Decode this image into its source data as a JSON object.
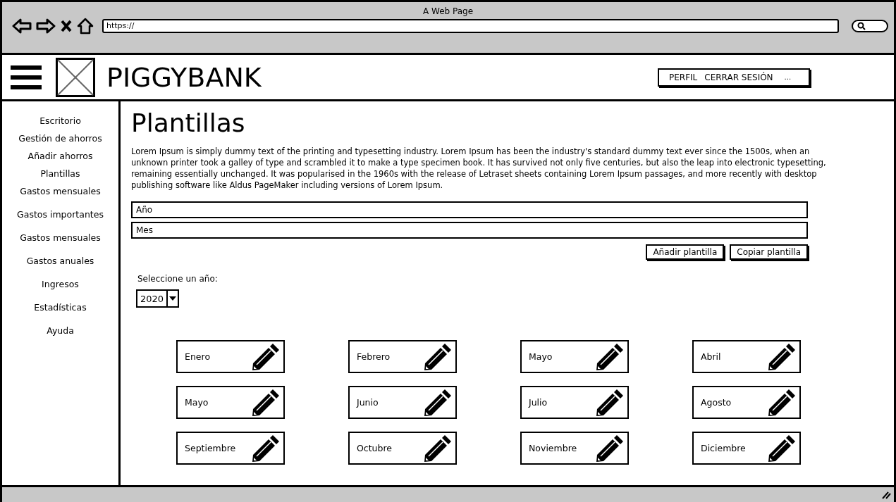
{
  "window": {
    "title": "A Web Page",
    "url": "https://"
  },
  "header": {
    "brand": "PIGGYBANK",
    "nav": [
      "PERFIL",
      "CERRAR SESIÓN",
      "..."
    ]
  },
  "sidebar": {
    "items": [
      {
        "label": "Escritorio"
      },
      {
        "label": "Gestión de ahorros"
      },
      {
        "label": "Añadir ahorros"
      },
      {
        "label": "Plantillas"
      },
      {
        "label": "Gastos mensuales"
      },
      {
        "label": "Gastos importantes"
      },
      {
        "label": "Gastos mensuales"
      },
      {
        "label": "Gastos anuales"
      },
      {
        "label": "Ingresos"
      },
      {
        "label": "Estadísticas"
      },
      {
        "label": "Ayuda"
      }
    ]
  },
  "main": {
    "title": "Plantillas",
    "description": "Lorem Ipsum is simply dummy text of the printing and typesetting industry. Lorem Ipsum has been the industry's standard dummy text ever since the 1500s, when an unknown printer took a galley of type and scrambled it to make a type specimen book. It has survived not only five centuries, but also the leap into electronic typesetting, remaining essentially unchanged. It was popularised in the 1960s with the release of Letraset sheets containing Lorem Ipsum passages, and more recently with desktop publishing software like Aldus PageMaker including versions of Lorem Ipsum.",
    "fields": [
      {
        "value": "Año"
      },
      {
        "value": "Mes"
      }
    ],
    "buttons": [
      "Añadir plantilla",
      "Copiar plantilla"
    ],
    "year_label": "Seleccione un año:",
    "year_select": {
      "value": "2020"
    },
    "months": [
      "Enero",
      "Febrero",
      "Mayo",
      "Abril",
      "Mayo",
      "Junio",
      "Julio",
      "Agosto",
      "Septiembre",
      "Octubre",
      "Noviembre",
      "Diciembre"
    ]
  }
}
